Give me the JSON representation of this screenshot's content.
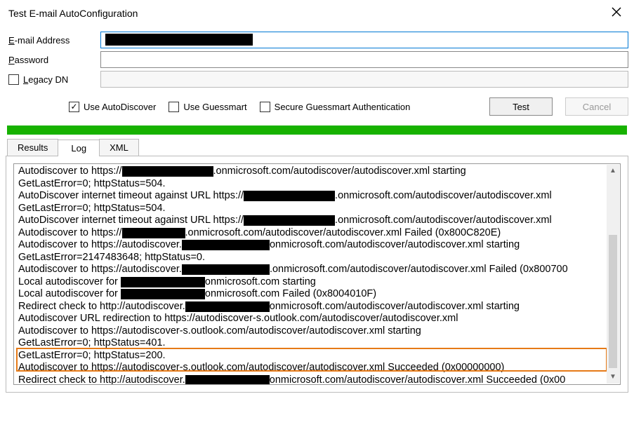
{
  "dialog": {
    "title": "Test E-mail AutoConfiguration"
  },
  "labels": {
    "email_pre": "",
    "email_u": "E",
    "email_post": "-mail Address",
    "password_pre": "",
    "password_u": "P",
    "password_post": "assword",
    "legacy_pre": "",
    "legacy_u": "L",
    "legacy_post": "egacy DN"
  },
  "fields": {
    "email_value": "██████████████████████",
    "password_value": "",
    "legacy_value": ""
  },
  "checks": {
    "autodiscover_pre": "Use Auto",
    "autodiscover_u": "D",
    "autodiscover_post": "iscover",
    "guessmart_pre": "Use G",
    "guessmart_u": "u",
    "guessmart_post": "essmart",
    "secure_pre": "Secure Gue",
    "secure_u": "s",
    "secure_post": "smart Authentication",
    "autodiscover_checked": true,
    "guessmart_checked": false,
    "secure_checked": false
  },
  "buttons": {
    "test": "Test",
    "cancel": "Cancel"
  },
  "tabs": {
    "results": "Results",
    "log": "Log",
    "xml": "XML",
    "active": "log"
  },
  "log_lines": [
    {
      "parts": [
        {
          "t": "Autodiscover to https://"
        },
        {
          "r": 130
        },
        {
          "t": ".onmicrosoft.com/autodiscover/autodiscover.xml starting"
        }
      ]
    },
    {
      "parts": [
        {
          "t": "GetLastError=0; httpStatus=504."
        }
      ]
    },
    {
      "parts": [
        {
          "t": "AutoDiscover internet timeout against URL https://"
        },
        {
          "r": 130
        },
        {
          "t": ".onmicrosoft.com/autodiscover/autodiscover.xml"
        }
      ]
    },
    {
      "parts": [
        {
          "t": "GetLastError=0; httpStatus=504."
        }
      ]
    },
    {
      "parts": [
        {
          "t": "AutoDiscover internet timeout against URL https://"
        },
        {
          "r": 130
        },
        {
          "t": ".onmicrosoft.com/autodiscover/autodiscover.xml"
        }
      ]
    },
    {
      "parts": [
        {
          "t": "Autodiscover to https://"
        },
        {
          "r": 90
        },
        {
          "t": ".onmicrosoft.com/autodiscover/autodiscover.xml Failed (0x800C820E)"
        }
      ]
    },
    {
      "parts": [
        {
          "t": "Autodiscover to https://autodiscover."
        },
        {
          "r": 125
        },
        {
          "t": "onmicrosoft.com/autodiscover/autodiscover.xml starting"
        }
      ]
    },
    {
      "parts": [
        {
          "t": "GetLastError=2147483648; httpStatus=0."
        }
      ]
    },
    {
      "parts": [
        {
          "t": "Autodiscover to https://autodiscover."
        },
        {
          "r": 125
        },
        {
          "t": ".onmicrosoft.com/autodiscover/autodiscover.xml Failed (0x800700"
        }
      ]
    },
    {
      "parts": [
        {
          "t": "Local autodiscover for "
        },
        {
          "r": 120
        },
        {
          "t": "onmicrosoft.com starting"
        }
      ]
    },
    {
      "parts": [
        {
          "t": "Local autodiscover for "
        },
        {
          "r": 120
        },
        {
          "t": "onmicrosoft.com Failed (0x8004010F)"
        }
      ]
    },
    {
      "parts": [
        {
          "t": "Redirect check to http://autodiscover."
        },
        {
          "r": 120
        },
        {
          "t": "onmicrosoft.com/autodiscover/autodiscover.xml starting"
        }
      ]
    },
    {
      "parts": [
        {
          "t": "Autodiscover URL redirection to https://autodiscover-s.outlook.com/autodiscover/autodiscover.xml"
        }
      ]
    },
    {
      "parts": [
        {
          "t": "Autodiscover to https://autodiscover-s.outlook.com/autodiscover/autodiscover.xml starting"
        }
      ]
    },
    {
      "parts": [
        {
          "t": "GetLastError=0; httpStatus=401."
        }
      ]
    },
    {
      "parts": [
        {
          "t": "GetLastError=0; httpStatus=200."
        }
      ]
    },
    {
      "parts": [
        {
          "t": "Autodiscover to https://autodiscover-s.outlook.com/autodiscover/autodiscover.xml Succeeded (0x00000000)"
        }
      ]
    },
    {
      "parts": [
        {
          "t": "Redirect check to http://autodiscover."
        },
        {
          "r": 120
        },
        {
          "t": "onmicrosoft.com/autodiscover/autodiscover.xml Succeeded (0x00"
        }
      ]
    }
  ]
}
